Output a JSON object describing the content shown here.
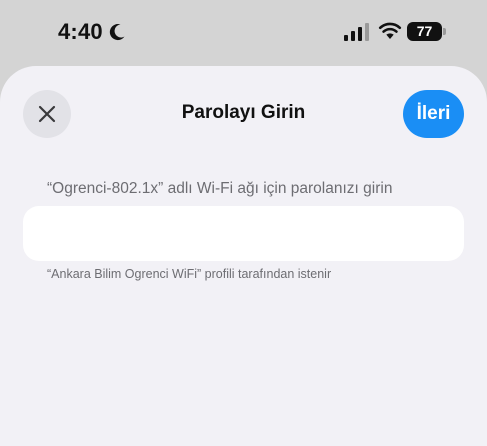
{
  "status_bar": {
    "time": "4:40",
    "battery_level": "77",
    "icons": [
      "moon-icon",
      "cellular-signal-icon",
      "wifi-icon",
      "battery-icon"
    ]
  },
  "sheet": {
    "title": "Parolayı Girin",
    "close_icon": "close-icon",
    "next_label": "İleri",
    "prompt": "“Ogrenci-802.1x” adlı Wi-Fi ağı için parolanızı girin",
    "password_value": "",
    "password_placeholder": "",
    "footer_note": "“Ankara Bilim Ogrenci WiFi” profili tarafından istenir"
  },
  "colors": {
    "accent": "#1a8ef5",
    "sheet_background": "#f2f1f6",
    "status_background": "#d4d4d4",
    "secondary_text": "#6d6d72"
  }
}
